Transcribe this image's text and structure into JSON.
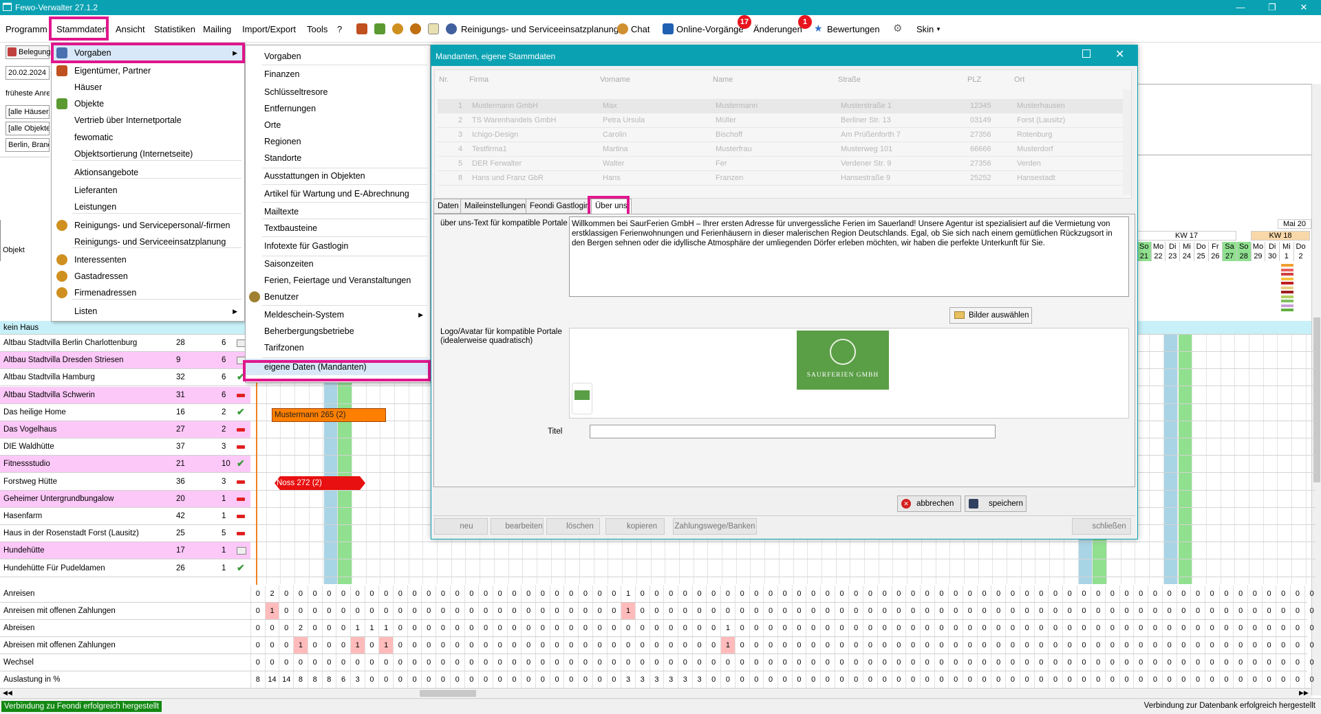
{
  "window": {
    "title": "Fewo-Verwalter 27.1.2"
  },
  "menubar": {
    "items": [
      "Programm",
      "Stammdaten",
      "Ansicht",
      "Statistiken",
      "Mailing",
      "Import/Export",
      "Tools",
      "?"
    ],
    "service_planning": "Reinigungs- und Serviceeinsatzplanung",
    "chat": "Chat",
    "online": "Online-Vorgänge",
    "online_badge": "17",
    "changes": "Änderungen",
    "changes_badge": "1",
    "reviews": "Bewertungen",
    "skin": "Skin"
  },
  "left": {
    "belegung_label": "Belegung",
    "date": "20.02.2024",
    "frueheste": "früheste Anrei",
    "haeuser": "[alle Häuser]",
    "objekte": "[alle Objekte]",
    "region": "Berlin, Brande",
    "objekt_header": "Objekt",
    "kein_haus": "kein Haus"
  },
  "objects": [
    {
      "name": "Altbau Stadtvilla Berlin Charlottenburg",
      "a": "28",
      "b": "6",
      "status": "calendar",
      "color": "white"
    },
    {
      "name": "Altbau Stadtvilla Dresden Striesen",
      "a": "9",
      "b": "6",
      "status": "calendar",
      "color": "pink"
    },
    {
      "name": "Altbau Stadtvilla Hamburg",
      "a": "32",
      "b": "6",
      "status": "check",
      "color": "white"
    },
    {
      "name": "Altbau Stadtvilla Schwerin",
      "a": "31",
      "b": "6",
      "status": "minus",
      "color": "pink"
    },
    {
      "name": "Das heilige Home",
      "a": "16",
      "b": "2",
      "status": "check",
      "color": "white"
    },
    {
      "name": "Das Vogelhaus",
      "a": "27",
      "b": "2",
      "status": "minus",
      "color": "pink"
    },
    {
      "name": "DIE Waldhütte",
      "a": "37",
      "b": "3",
      "status": "minus",
      "color": "white"
    },
    {
      "name": "Fitnessstudio",
      "a": "21",
      "b": "10",
      "status": "check",
      "color": "pink"
    },
    {
      "name": "Forstweg Hütte",
      "a": "36",
      "b": "3",
      "status": "minus",
      "color": "white"
    },
    {
      "name": "Geheimer Untergrundbungalow",
      "a": "20",
      "b": "1",
      "status": "minus",
      "color": "pink"
    },
    {
      "name": "Hasenfarm",
      "a": "42",
      "b": "1",
      "status": "minus",
      "color": "white"
    },
    {
      "name": "Haus in der Rosenstadt Forst (Lausitz)",
      "a": "25",
      "b": "5",
      "status": "minus",
      "color": "white"
    },
    {
      "name": "Hundehütte",
      "a": "17",
      "b": "1",
      "status": "calendar",
      "color": "pink"
    },
    {
      "name": "Hundehütte Für Pudeldamen",
      "a": "26",
      "b": "1",
      "status": "check",
      "color": "white"
    }
  ],
  "bookings": [
    {
      "label": "Mustermann 265 (2)",
      "color": "#ff8000"
    },
    {
      "label": "Noss 272 (2)",
      "color": "#e81010"
    }
  ],
  "stats": [
    {
      "label": "Anreisen",
      "values": [
        "0",
        "2",
        "0",
        "0",
        "0",
        "0",
        "0",
        "0",
        "0",
        "0",
        "0",
        "0",
        "0",
        "0",
        "0",
        "0",
        "0",
        "0",
        "0",
        "0",
        "0",
        "0",
        "0",
        "0",
        "0",
        "0",
        "1",
        "0",
        "0",
        "0",
        "0",
        "0",
        "0",
        "0",
        "0",
        "0",
        "0",
        "0",
        "0",
        "0",
        "0",
        "0",
        "0",
        "0",
        "0",
        "0",
        "0",
        "0",
        "0",
        "0",
        "0",
        "0",
        "0",
        "0",
        "0",
        "0",
        "0",
        "0",
        "0",
        "0",
        "0",
        "0",
        "0",
        "0",
        "0",
        "0",
        "0",
        "0",
        "0",
        "0",
        "0",
        "0",
        "0",
        "0",
        "0",
        "0",
        "0",
        "0",
        "0",
        "0",
        "0",
        "0",
        "0",
        "0",
        "0",
        "0",
        "0",
        "0",
        "0",
        "0",
        "0",
        "0"
      ],
      "red": []
    },
    {
      "label": "Anreisen mit offenen Zahlungen",
      "values": [
        "0",
        "1",
        "0",
        "0",
        "0",
        "0",
        "0",
        "0",
        "0",
        "0",
        "0",
        "0",
        "0",
        "0",
        "0",
        "0",
        "0",
        "0",
        "0",
        "0",
        "0",
        "0",
        "0",
        "0",
        "0",
        "0",
        "1",
        "0",
        "0",
        "0",
        "0",
        "0",
        "0",
        "0",
        "0",
        "0",
        "0",
        "0",
        "0",
        "0",
        "0",
        "0",
        "0",
        "0",
        "0",
        "0",
        "0",
        "0",
        "0",
        "0",
        "0",
        "0",
        "0",
        "0",
        "0",
        "0",
        "0",
        "0",
        "0",
        "0",
        "0",
        "0",
        "0",
        "0",
        "0",
        "0",
        "0",
        "0",
        "0",
        "0",
        "0",
        "0",
        "0",
        "0",
        "0",
        "0",
        "0",
        "0",
        "0",
        "0",
        "0",
        "0",
        "0",
        "0",
        "0",
        "0",
        "0",
        "0",
        "0",
        "0",
        "0",
        "0"
      ],
      "red": [
        1,
        26
      ]
    },
    {
      "label": "Abreisen",
      "values": [
        "0",
        "0",
        "0",
        "2",
        "0",
        "0",
        "0",
        "1",
        "1",
        "1",
        "0",
        "0",
        "0",
        "0",
        "0",
        "0",
        "0",
        "0",
        "0",
        "0",
        "0",
        "0",
        "0",
        "0",
        "0",
        "0",
        "0",
        "0",
        "0",
        "0",
        "0",
        "0",
        "0",
        "1",
        "0",
        "0",
        "0",
        "0",
        "0",
        "0",
        "0",
        "0",
        "0",
        "0",
        "0",
        "0",
        "0",
        "0",
        "0",
        "0",
        "0",
        "0",
        "0",
        "0",
        "0",
        "0",
        "0",
        "0",
        "0",
        "0",
        "0",
        "0",
        "0",
        "0",
        "0",
        "0",
        "0",
        "0",
        "0",
        "0",
        "0",
        "0",
        "0",
        "0",
        "0",
        "0",
        "0",
        "0",
        "0",
        "0",
        "0",
        "0",
        "0",
        "0",
        "0",
        "0",
        "0",
        "0",
        "0",
        "0",
        "0",
        "0"
      ],
      "red": []
    },
    {
      "label": "Abreisen mit offenen Zahlungen",
      "values": [
        "0",
        "0",
        "0",
        "1",
        "0",
        "0",
        "0",
        "1",
        "0",
        "1",
        "0",
        "0",
        "0",
        "0",
        "0",
        "0",
        "0",
        "0",
        "0",
        "0",
        "0",
        "0",
        "0",
        "0",
        "0",
        "0",
        "0",
        "0",
        "0",
        "0",
        "0",
        "0",
        "0",
        "1",
        "0",
        "0",
        "0",
        "0",
        "0",
        "0",
        "0",
        "0",
        "0",
        "0",
        "0",
        "0",
        "0",
        "0",
        "0",
        "0",
        "0",
        "0",
        "0",
        "0",
        "0",
        "0",
        "0",
        "0",
        "0",
        "0",
        "0",
        "0",
        "0",
        "0",
        "0",
        "0",
        "0",
        "0",
        "0",
        "0",
        "0",
        "0",
        "0",
        "0",
        "0",
        "0",
        "0",
        "0",
        "0",
        "0",
        "0",
        "0",
        "0",
        "0",
        "0",
        "0",
        "0",
        "0",
        "0",
        "0",
        "0",
        "0"
      ],
      "red": [
        3,
        7,
        9,
        33
      ]
    },
    {
      "label": "Wechsel",
      "values": [
        "0",
        "0",
        "0",
        "0",
        "0",
        "0",
        "0",
        "0",
        "0",
        "0",
        "0",
        "0",
        "0",
        "0",
        "0",
        "0",
        "0",
        "0",
        "0",
        "0",
        "0",
        "0",
        "0",
        "0",
        "0",
        "0",
        "0",
        "0",
        "0",
        "0",
        "0",
        "0",
        "0",
        "0",
        "0",
        "0",
        "0",
        "0",
        "0",
        "0",
        "0",
        "0",
        "0",
        "0",
        "0",
        "0",
        "0",
        "0",
        "0",
        "0",
        "0",
        "0",
        "0",
        "0",
        "0",
        "0",
        "0",
        "0",
        "0",
        "0",
        "0",
        "0",
        "0",
        "0",
        "0",
        "0",
        "0",
        "0",
        "0",
        "0",
        "0",
        "0",
        "0",
        "0",
        "0",
        "0",
        "0",
        "0",
        "0",
        "0",
        "0",
        "0",
        "0",
        "0",
        "0",
        "0",
        "0",
        "0",
        "0",
        "0",
        "0",
        "0"
      ],
      "red": []
    },
    {
      "label": "Auslastung in %",
      "values": [
        "8",
        "14",
        "14",
        "8",
        "8",
        "8",
        "6",
        "3",
        "0",
        "0",
        "0",
        "0",
        "0",
        "0",
        "0",
        "0",
        "0",
        "0",
        "0",
        "0",
        "0",
        "0",
        "0",
        "0",
        "0",
        "0",
        "3",
        "3",
        "3",
        "3",
        "3",
        "3",
        "0",
        "0",
        "0",
        "0",
        "0",
        "0",
        "0",
        "0",
        "0",
        "0",
        "0",
        "0",
        "0",
        "0",
        "0",
        "0",
        "0",
        "0",
        "0",
        "0",
        "0",
        "0",
        "0",
        "0",
        "0",
        "0",
        "0",
        "0",
        "0",
        "0",
        "0",
        "0",
        "0",
        "0",
        "0",
        "0",
        "0",
        "0",
        "0",
        "0",
        "0",
        "0",
        "0",
        "0",
        "0",
        "0",
        "0",
        "0",
        "0",
        "0",
        "0",
        "0",
        "0",
        "0",
        "0",
        "0",
        "0",
        "0",
        "0",
        "0"
      ],
      "red": []
    }
  ],
  "stammdaten_menu": [
    {
      "label": "Vorgaben",
      "icon": "calendar-icon",
      "sub": true
    },
    {
      "label": "Eigentümer, Partner",
      "icon": "owner-icon"
    },
    {
      "label": "Häuser",
      "icon": ""
    },
    {
      "label": "Objekte",
      "icon": "house-icon"
    },
    {
      "label": "Vertrieb über Internetportale",
      "icon": ""
    },
    {
      "label": "fewomatic",
      "icon": ""
    },
    {
      "label": "Objektsortierung (Internetseite)",
      "icon": ""
    },
    {
      "label": "Aktionsangebote",
      "icon": ""
    },
    {
      "label": "Lieferanten",
      "icon": ""
    },
    {
      "label": "Leistungen",
      "icon": ""
    },
    {
      "label": "Reinigungs- und Servicepersonal/-firmen",
      "icon": "person-icon"
    },
    {
      "label": "Reinigungs- und Serviceeinsatzplanung",
      "icon": ""
    },
    {
      "label": "Interessenten",
      "icon": "person-icon"
    },
    {
      "label": "Gastadressen",
      "icon": "person-icon"
    },
    {
      "label": "Firmenadressen",
      "icon": "person-icon"
    },
    {
      "label": "Listen",
      "icon": "",
      "sub": true
    }
  ],
  "vorgaben_menu": [
    "Vorgaben",
    "Finanzen",
    "Schlüsseltresore",
    "Entfernungen",
    "Orte",
    "Regionen",
    "Standorte",
    "Ausstattungen in Objekten",
    "Artikel für Wartung und E-Abrechnung",
    "Mailtexte",
    "Textbausteine",
    "Infotexte für Gastlogin",
    "Saisonzeiten",
    "Ferien, Feiertage und Veranstaltungen",
    "Benutzer",
    "Meldeschein-System",
    "Beherbergungsbetriebe",
    "Tarifzonen",
    "eigene Daten (Mandanten)"
  ],
  "dialog": {
    "title": "Mandanten, eigene Stammdaten",
    "columns": [
      "Nr.",
      "Firma",
      "Vorname",
      "Name",
      "Straße",
      "PLZ",
      "Ort"
    ],
    "rows": [
      [
        "1",
        "Mustermann GmbH",
        "Max",
        "Mustermann",
        "Musterstraße 1",
        "12345",
        "Musterhausen"
      ],
      [
        "2",
        "TS Warenhandels GmbH",
        "Petra Ursula",
        "Müller",
        "Berliner Str. 13",
        "03149",
        "Forst (Lausitz)"
      ],
      [
        "3",
        "Ichigo-Design",
        "Carolin",
        "Bischoff",
        "Am Prüßenforth 7",
        "27356",
        "Rotenburg"
      ],
      [
        "4",
        "Testfirma1",
        "Martina",
        "Musterfrau",
        "Musterweg 101",
        "66666",
        "Musterdorf"
      ],
      [
        "5",
        "DER Ferwalter",
        "Walter",
        "Fer",
        "Verdener Str. 9",
        "27356",
        "Verden"
      ],
      [
        "8",
        "Hans und Franz GbR",
        "Hans",
        "Franzen",
        "Hansestraße 9",
        "25252",
        "Hansestadt"
      ]
    ],
    "tabs": [
      "Daten",
      "Maileinstellungen",
      "Feondi Gastlogin",
      "Über uns"
    ],
    "about_label": "über uns-Text für kompatible Portale",
    "about_text": "Willkommen bei SaurFerien GmbH – Ihrer ersten Adresse für unvergessliche Ferien im Sauerland! Unsere Agentur ist spezialisiert auf die Vermietung von erstklassigen Ferienwohnungen und Ferienhäusern in dieser malerischen Region Deutschlands. Egal, ob Sie sich nach einem gemütlichen Rückzugsort in den Bergen sehnen oder die idyllische Atmosphäre der umliegenden Dörfer erleben möchten, wir haben die perfekte Unterkunft für Sie.",
    "bilder_btn": "Bilder auswählen",
    "logo_label": "Logo/Avatar für kompatible Portale (idealerweise quadratisch)",
    "logo_text": "SAURFERIEN GMBH",
    "titel_label": "Titel",
    "titel_value": "",
    "cancel": "abbrechen",
    "save": "speichern",
    "footer": [
      "neu",
      "bearbeiten",
      "löschen",
      "kopieren",
      "Zahlungswege/Banken",
      "schließen"
    ]
  },
  "calendar_header": {
    "month": "Mai 20",
    "kw17": "KW 17",
    "kw18": "KW 18",
    "days": [
      "So",
      "Mo",
      "Di",
      "Mi",
      "Do",
      "Fr",
      "Sa",
      "So",
      "Mo",
      "Di",
      "Mi",
      "Do"
    ],
    "dates": [
      "21",
      "22",
      "23",
      "24",
      "25",
      "26",
      "27",
      "28",
      "29",
      "30",
      "1",
      "2"
    ]
  },
  "status": {
    "left": "Verbindung zu Feondi erfolgreich hergestellt",
    "right": "Verbindung zur Datenbank erfolgreich hergestellt"
  },
  "colors": {
    "accent": "#0aa2b3",
    "highlight": "#e0168c",
    "pink_row": "#fcc8f8",
    "weekend_green": "#90e090",
    "column_blue": "#a8d4e6",
    "status_green": "#128812"
  }
}
